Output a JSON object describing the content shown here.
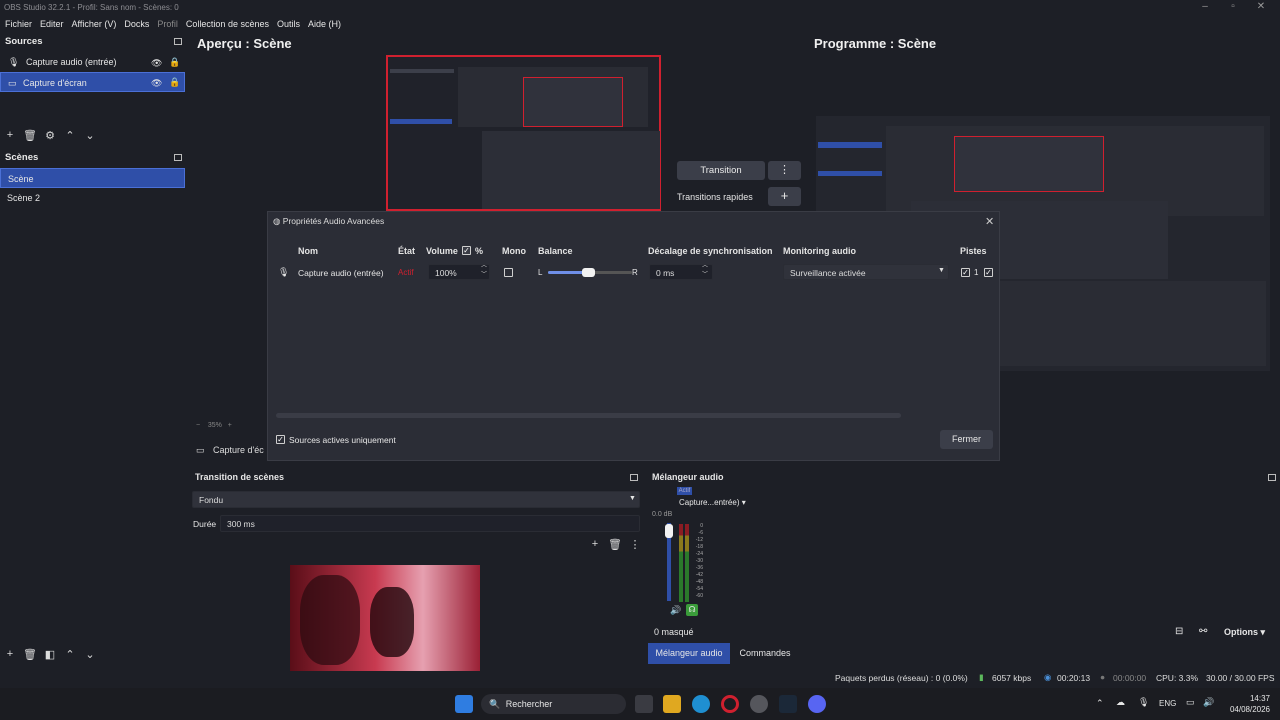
{
  "window": {
    "title": "OBS Studio 32.2.1 - Profil: Sans nom - Scènes: 0"
  },
  "menu": [
    "Fichier",
    "Editer",
    "Afficher (V)",
    "Docks",
    "Profil",
    "Collection de scènes",
    "Outils",
    "Aide (H)"
  ],
  "sources": {
    "title": "Sources",
    "items": [
      "Capture audio (entrée)",
      "Capture d'écran"
    ]
  },
  "scenes": {
    "title": "Scènes",
    "items": [
      "Scène",
      "Scène 2"
    ]
  },
  "preview": {
    "title": "Aperçu : Scène",
    "zoom": "35%",
    "source_label": "Capture d'éc"
  },
  "program": {
    "title": "Programme : Scène"
  },
  "transition_panel": {
    "button": "Transition",
    "quick": "Transitions rapides"
  },
  "dialog": {
    "title": "Propriétés Audio Avancées",
    "headers": {
      "name": "Nom",
      "state": "État",
      "volume": "Volume",
      "pct": "%",
      "mono": "Mono",
      "balance": "Balance",
      "sync": "Décalage de synchronisation",
      "monitoring": "Monitoring audio",
      "tracks": "Pistes"
    },
    "row": {
      "name": "Capture audio (entrée)",
      "state": "Actif",
      "volume": "100%",
      "balance_l": "L",
      "balance_r": "R",
      "sync": "0 ms",
      "monitoring": "Surveillance activée",
      "track1": "1"
    },
    "active_only": "Sources actives uniquement",
    "close": "Fermer"
  },
  "scene_transitions": {
    "title": "Transition de scènes",
    "type": "Fondu",
    "duration_label": "Durée",
    "duration": "300 ms"
  },
  "mixer": {
    "title": "Mélangeur audio",
    "active": "Actif",
    "channel": "Capture...entrée)",
    "db": "0.0 dB",
    "scale": [
      "0",
      "-6",
      "-12",
      "-18",
      "-24",
      "-30",
      "-36",
      "-42",
      "-48",
      "-54",
      "-60"
    ],
    "hidden": "0 masqué",
    "options": "Options",
    "tab_mixer": "Mélangeur audio",
    "tab_commands": "Commandes"
  },
  "status": {
    "dropped": "Paquets perdus (réseau) : 0 (0.0%)",
    "bitrate": "6057 kbps",
    "rec_time": "00:20:13",
    "stream_time": "00:00:00",
    "cpu": "CPU: 3.3%",
    "fps": "30.00 / 30.00 FPS"
  },
  "taskbar": {
    "search": "Rechercher",
    "lang": "ENG",
    "time": "14:37",
    "date": "04/08/2026"
  },
  "colors": {
    "accent": "#2f4fa8",
    "active_red": "#d0202f",
    "meter_green": "#5cb85c"
  }
}
